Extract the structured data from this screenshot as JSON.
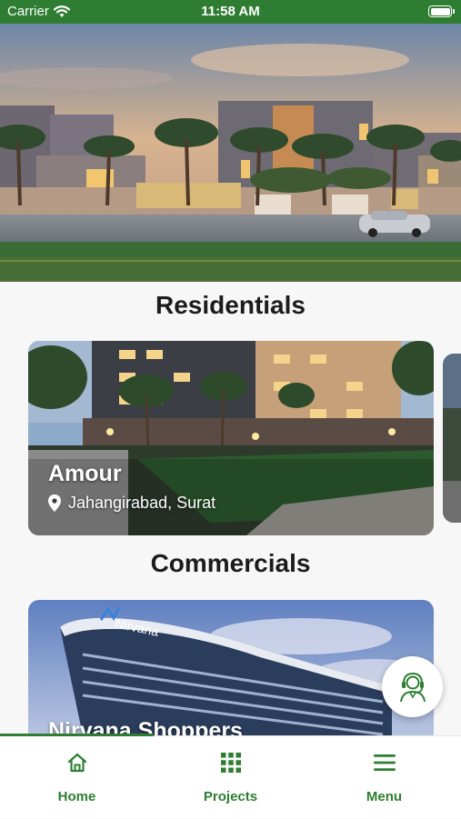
{
  "status_bar": {
    "carrier": "Carrier",
    "time": "11:58 AM"
  },
  "sections": {
    "residentials": "Residentials",
    "commercials": "Commercials"
  },
  "residential_cards": [
    {
      "name": "Amour",
      "location": "Jahangirabad, Surat"
    }
  ],
  "commercial_cards": [
    {
      "name": "Nirvana Shoppers",
      "sign": "Nirvana"
    }
  ],
  "bottom_nav": {
    "items": [
      {
        "label": "Home",
        "icon": "home-icon"
      },
      {
        "label": "Projects",
        "icon": "grid-icon"
      },
      {
        "label": "Menu",
        "icon": "menu-icon"
      }
    ],
    "active_index": 0
  },
  "colors": {
    "brand_green": "#2e7d32"
  }
}
